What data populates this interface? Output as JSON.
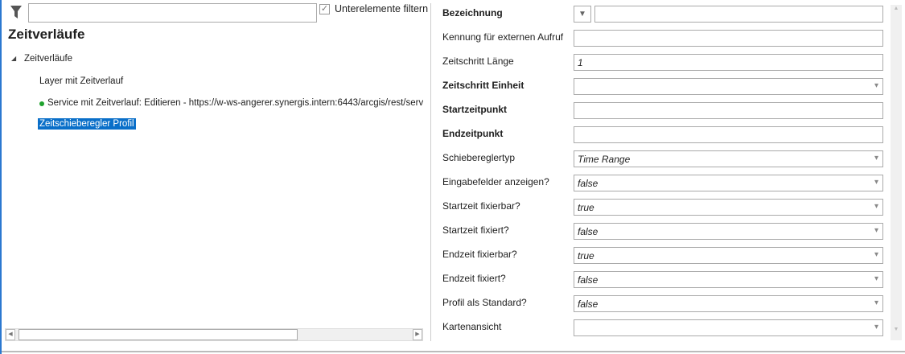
{
  "left": {
    "filter_placeholder": "",
    "filter_children_label": "Unterelemente filtern",
    "filter_children_checked": true,
    "title": "Zeitverläufe",
    "tree": {
      "root": "Zeitverläufe",
      "items": [
        "Layer mit Zeitverlauf",
        "Service mit Zeitverlauf: Editieren - https://w-ws-angerer.synergis.intern:6443/arcgis/rest/serv",
        "Zeitschieberegler Profil"
      ],
      "selected": "Zeitschieberegler Profil",
      "status_color": "#1fa22e"
    }
  },
  "form": [
    {
      "label": "Bezeichnung",
      "value": ""
    },
    {
      "label": "Kennung für externen Aufruf",
      "value": ""
    },
    {
      "label": "Zeitschritt Länge",
      "value": "1"
    },
    {
      "label": "Zeitschritt Einheit",
      "value": ""
    },
    {
      "label": "Startzeitpunkt",
      "value": ""
    },
    {
      "label": "Endzeitpunkt",
      "value": ""
    },
    {
      "label": "Schiebereglertyp",
      "value": "Time Range"
    },
    {
      "label": "Eingabefelder anzeigen?",
      "value": "false"
    },
    {
      "label": "Startzeit fixierbar?",
      "value": "true"
    },
    {
      "label": "Startzeit fixiert?",
      "value": "false"
    },
    {
      "label": "Endzeit fixierbar?",
      "value": "true"
    },
    {
      "label": "Endzeit fixiert?",
      "value": "false"
    },
    {
      "label": "Profil als Standard?",
      "value": "false"
    },
    {
      "label": "Kartenansicht",
      "value": ""
    }
  ]
}
